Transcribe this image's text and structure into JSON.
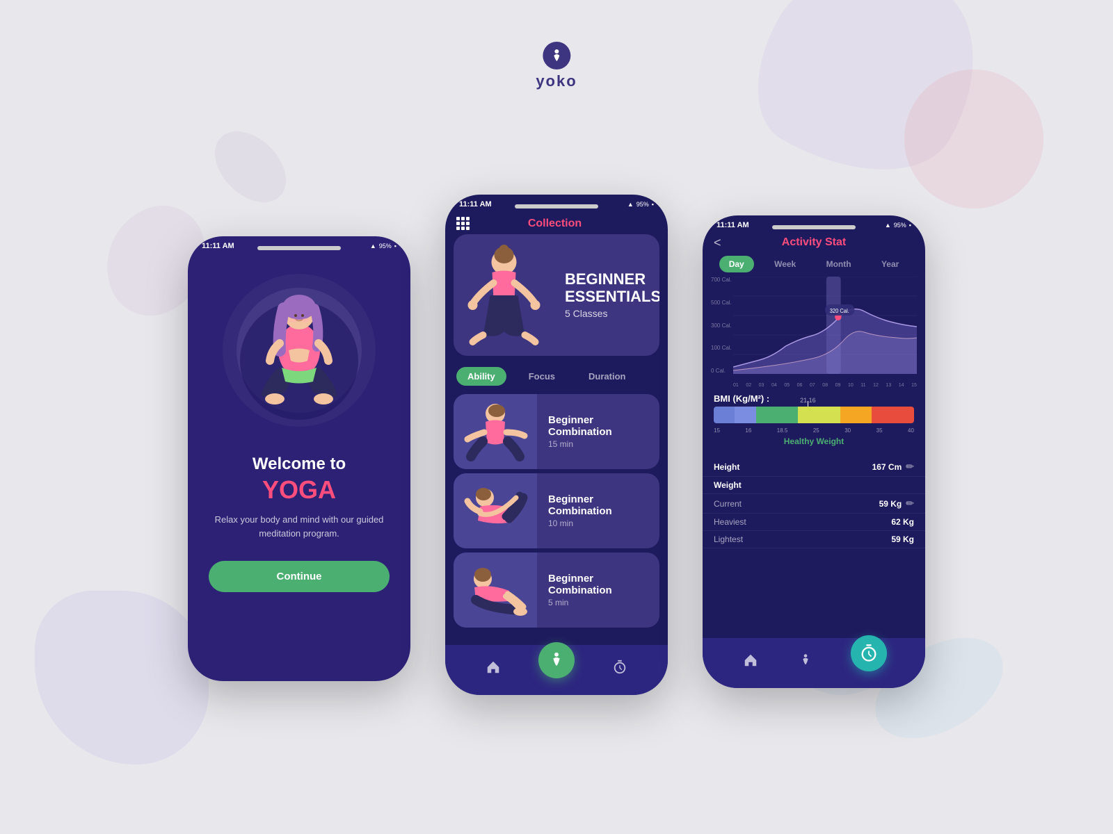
{
  "app": {
    "name": "yoko",
    "logo_symbol": "🧘"
  },
  "background": {
    "color": "#e8e8ec"
  },
  "phone1": {
    "status_bar": {
      "time": "11:11 AM",
      "battery": "95%",
      "signal": "▲"
    },
    "welcome": {
      "title": "Welcome to",
      "yoga_text": "YOGA",
      "description": "Relax your body and mind with our guided meditation program.",
      "continue_btn": "Continue"
    }
  },
  "phone2": {
    "status_bar": {
      "time": "11:11 AM",
      "battery": "95%"
    },
    "header": {
      "title": "Collection"
    },
    "banner": {
      "title": "BEGINNER\nESSENTIALS",
      "subtitle": "5 Classes"
    },
    "tabs": [
      {
        "label": "Ability",
        "active": true
      },
      {
        "label": "Focus",
        "active": false
      },
      {
        "label": "Duration",
        "active": false
      }
    ],
    "classes": [
      {
        "title": "Beginner Combination",
        "duration": "15 min"
      },
      {
        "title": "Beginner Combination",
        "duration": "10 min"
      },
      {
        "title": "Beginner Combination",
        "duration": "5 min"
      }
    ],
    "nav": {
      "home": "🏠",
      "yoga": "🧘",
      "timer": "⏱"
    }
  },
  "phone3": {
    "status_bar": {
      "time": "11:11 AM",
      "battery": "95%"
    },
    "header": {
      "title": "Activity Stat",
      "back": "<"
    },
    "period_tabs": [
      {
        "label": "Day",
        "active": true
      },
      {
        "label": "Week",
        "active": false
      },
      {
        "label": "Month",
        "active": false
      },
      {
        "label": "Year",
        "active": false
      }
    ],
    "chart": {
      "y_labels": [
        "700 Cal.",
        "500 Cal.",
        "300 Cal.",
        "100 Cal.",
        "0 Cal."
      ],
      "x_labels": [
        "01",
        "02",
        "03",
        "04",
        "05",
        "06",
        "07",
        "08",
        "09",
        "10",
        "11",
        "12",
        "13",
        "14",
        "15"
      ],
      "peak_value": "320 Cal.",
      "peak_x": "08"
    },
    "bmi": {
      "title": "BMI (Kg/M²) :",
      "current_value": "21.16",
      "labels": [
        "15",
        "16",
        "18.5",
        "25",
        "30",
        "35",
        "40"
      ],
      "status": "Healthy Weight",
      "segments": [
        {
          "color": "#6b7fd7",
          "flex": 1
        },
        {
          "color": "#7b8de0",
          "flex": 1
        },
        {
          "color": "#4caf72",
          "flex": 2
        },
        {
          "color": "#d4e04f",
          "flex": 2
        },
        {
          "color": "#f5a623",
          "flex": 1.5
        },
        {
          "color": "#e74c3c",
          "flex": 2
        }
      ]
    },
    "stats": {
      "height_label": "Height",
      "height_value": "167 Cm",
      "weight_label": "Weight",
      "current_label": "Current",
      "current_value": "59 Kg",
      "heaviest_label": "Heaviest",
      "heaviest_value": "62 Kg",
      "lightest_label": "Lightest",
      "lightest_value": "59 Kg"
    },
    "nav": {
      "home": "🏠",
      "yoga": "🧘",
      "timer": "⏱"
    }
  }
}
